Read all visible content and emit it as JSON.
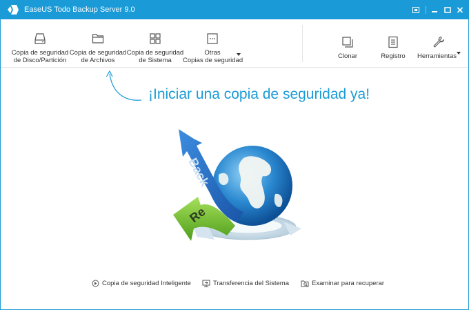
{
  "window": {
    "title": "EaseUS Todo Backup Server 9.0",
    "accent_color": "#1a9bd7"
  },
  "titlebar_icons": [
    "app-logo-icon",
    "restore-icon",
    "minimize-icon",
    "maximize-icon",
    "close-icon"
  ],
  "toolbar": {
    "disk_backup": {
      "line1": "Copia de seguridad",
      "line2": "de Disco/Partición",
      "icon": "disk-icon"
    },
    "file_backup": {
      "line1": "Copia de seguridad",
      "line2": "de Archivos",
      "icon": "folder-icon"
    },
    "system_backup": {
      "line1": "Copia de seguridad",
      "line2": "de Sistema",
      "icon": "windows-icon"
    },
    "other_backup": {
      "line1": "Otras",
      "line2": "Copias de seguridad",
      "icon": "more-icon"
    },
    "clone": {
      "label": "Clonar",
      "icon": "clone-icon"
    },
    "log": {
      "label": "Registro",
      "icon": "log-icon"
    },
    "tools": {
      "label": "Herramientas",
      "icon": "wrench-icon"
    }
  },
  "main": {
    "headline": "¡Iniciar una copia de seguridad ya!",
    "hero_text_back": "Back",
    "hero_text_re": "Re"
  },
  "links": {
    "smart_backup": {
      "label": "Copia de seguridad Inteligente",
      "icon": "smart-backup-icon"
    },
    "system_transfer": {
      "label": "Transferencia del Sistema",
      "icon": "system-transfer-icon"
    },
    "browse_recover": {
      "label": "Examinar para recuperar",
      "icon": "browse-recover-icon"
    }
  }
}
